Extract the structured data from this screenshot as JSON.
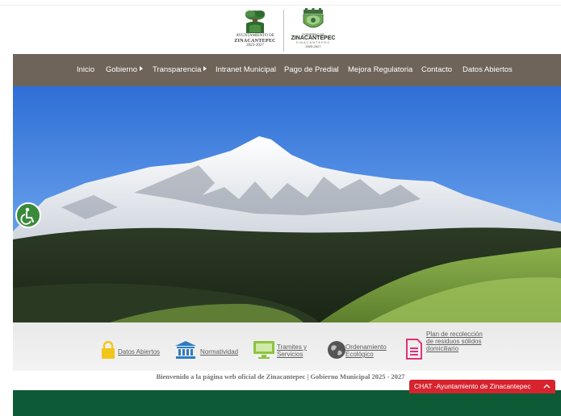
{
  "header": {
    "logo_left": {
      "line1": "AYUNTAMIENTO DE",
      "line2": "ZINACANTEPEC",
      "line3": "2025-2027"
    },
    "logo_right": {
      "line1": "GOBIERNO DE",
      "line2": "ZINACANTEPEC",
      "line3": "ZINACANTEPEC",
      "line4": "2025-2027"
    }
  },
  "nav": {
    "items": [
      {
        "label": "Inicio",
        "has_caret": false
      },
      {
        "label": "Gobierno",
        "has_caret": true
      },
      {
        "label": "Transparencia",
        "has_caret": true
      },
      {
        "label": "Intranet Municipal",
        "has_caret": false
      },
      {
        "label": "Pago de Predial",
        "has_caret": false
      },
      {
        "label": "Mejora Regulatoria",
        "has_caret": false
      },
      {
        "label": "Contacto",
        "has_caret": false
      },
      {
        "label": "Datos Abiertos",
        "has_caret": false
      }
    ]
  },
  "quick_links": [
    {
      "label": "Datos Abiertos",
      "icon": "padlock-icon",
      "color": "#f2c51a"
    },
    {
      "label": "Normatividad",
      "icon": "bank-icon",
      "color": "#2d7cc1"
    },
    {
      "label": "Tramites y Servicios",
      "icon": "monitor-icon",
      "color": "#8cc43f"
    },
    {
      "label": "Ordenamiento Ecológico",
      "icon": "globe-icon",
      "color": "#555555"
    },
    {
      "label": "Plan de recolección de residuos sólidos domiciliario",
      "icon": "document-icon",
      "color": "#e0317a"
    }
  ],
  "welcome_text": "Bienvenido a la página web oficial de Zinacantepec | Gobierno Municipal 2025 - 2027",
  "chat": {
    "label": "CHAT -Ayuntamiento de Zinacantepec",
    "chevron": "^"
  },
  "colors": {
    "nav_bg": "#6e6459",
    "footer_bg": "#0d5a37",
    "chat_bg": "#d6232d",
    "accessibility_bg": "#3a8a3b"
  },
  "accessibility": {
    "icon": "wheelchair-icon"
  }
}
